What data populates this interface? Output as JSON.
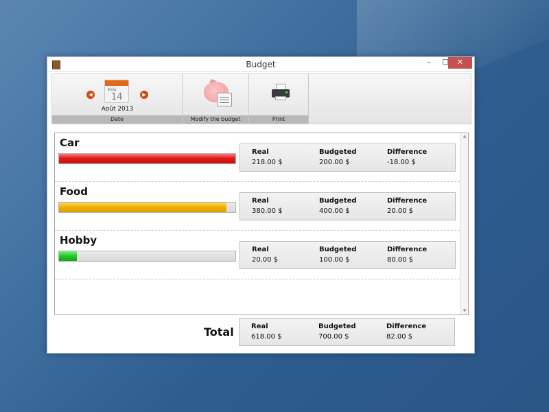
{
  "window": {
    "title": "Budget",
    "min": "–",
    "max": "☐",
    "close": "✕"
  },
  "ribbon": {
    "date": {
      "month_short": "Feb",
      "day": "14",
      "current": "Août 2013",
      "label": "Date",
      "prev": "◀",
      "next": "▶"
    },
    "modify_label": "Modify the budget",
    "print_label": "Print"
  },
  "headers": {
    "real": "Real",
    "budgeted": "Budgeted",
    "difference": "Difference"
  },
  "categories": [
    {
      "name": "Car",
      "real": "218.00 $",
      "budgeted": "200.00 $",
      "difference": "-18.00 $",
      "usage_ratio": 1.0,
      "color": "#e11d1d"
    },
    {
      "name": "Food",
      "real": "380.00 $",
      "budgeted": "400.00 $",
      "difference": "20.00 $",
      "usage_ratio": 0.95,
      "color": "#eeb000"
    },
    {
      "name": "Hobby",
      "real": "20.00 $",
      "budgeted": "100.00 $",
      "difference": "80.00 $",
      "usage_ratio": 0.2,
      "color": "#26c526"
    }
  ],
  "total": {
    "label": "Total",
    "real": "618.00 $",
    "budgeted": "700.00 $",
    "difference": "82.00 $"
  },
  "icons": {
    "app": "budget-book-icon",
    "calendar": "calendar-icon",
    "modify": "piggy-bank-icon",
    "print": "printer-icon"
  }
}
